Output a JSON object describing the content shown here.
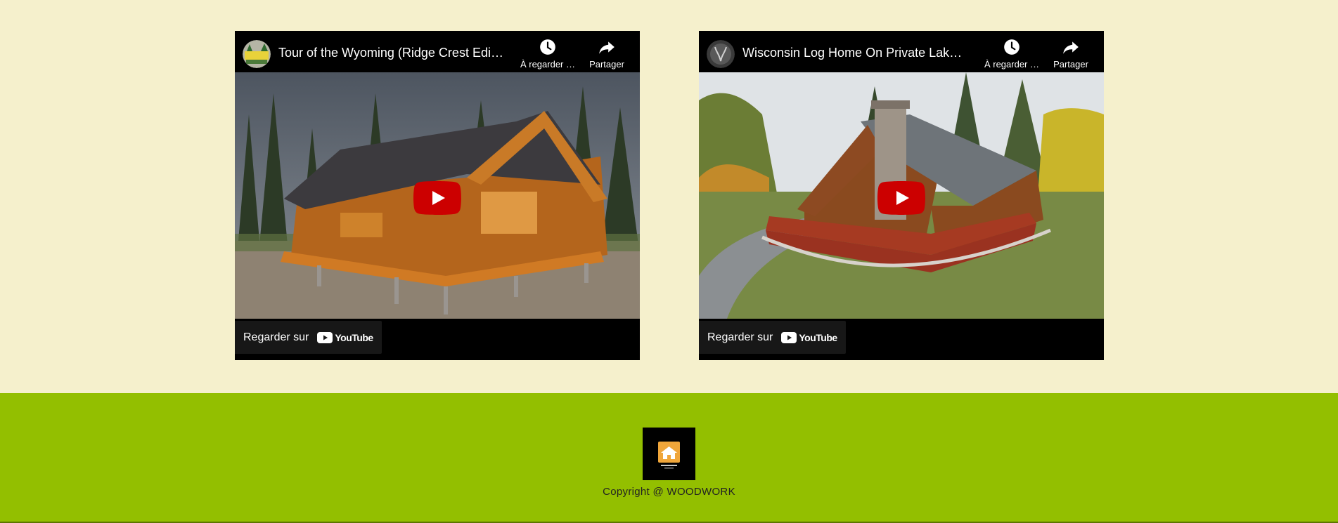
{
  "videos": [
    {
      "title": "Tour of the Wyoming (Ridge Crest Editi…",
      "watch_later": "À regarder …",
      "share": "Partager",
      "watch_on": "Regarder sur",
      "youtube_word": "YouTube"
    },
    {
      "title": "Wisconsin Log Home On Private Lake F…",
      "watch_later": "À regarder …",
      "share": "Partager",
      "watch_on": "Regarder sur",
      "youtube_word": "YouTube"
    }
  ],
  "footer": {
    "copyright": "Copyright @ WOODWORK"
  },
  "colors": {
    "page_bg": "#f5f0cc",
    "footer_bg": "#93bf00",
    "play_red": "#cc0000",
    "logo_orange": "#f0a63a"
  }
}
